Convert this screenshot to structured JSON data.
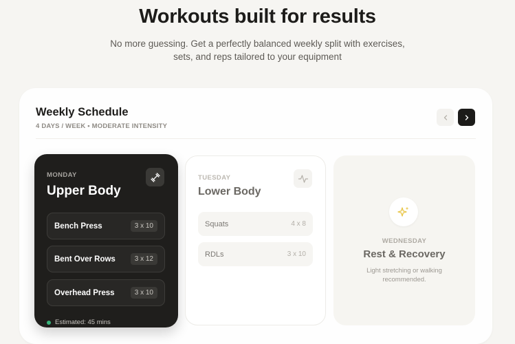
{
  "hero": {
    "title": "Workouts built for results",
    "subtitle_line1": "No more guessing. Get a perfectly balanced weekly split with exercises,",
    "subtitle_line2": "sets, and reps tailored to your equipment"
  },
  "schedule": {
    "title": "Weekly Schedule",
    "meta": "4 DAYS / WEEK • MODERATE INTENSITY",
    "prev_icon": "chevron-left-icon",
    "next_icon": "chevron-right-icon"
  },
  "monday": {
    "day": "MONDAY",
    "title": "Upper Body",
    "icon": "dumbbell-icon",
    "exercises": [
      {
        "name": "Bench Press",
        "sets": "3 x 10"
      },
      {
        "name": "Bent Over Rows",
        "sets": "3 x 12"
      },
      {
        "name": "Overhead Press",
        "sets": "3 x 10"
      }
    ],
    "estimated": "Estimated: 45 mins",
    "status_color": "#37b37a"
  },
  "tuesday": {
    "day": "TUESDAY",
    "title": "Lower Body",
    "icon": "activity-icon",
    "exercises": [
      {
        "name": "Squats",
        "sets": "4 x 8"
      },
      {
        "name": "RDLs",
        "sets": "3 x 10"
      }
    ]
  },
  "wednesday": {
    "day": "WEDNESDAY",
    "title": "Rest & Recovery",
    "icon": "sparkles-icon",
    "description_line1": "Light stretching or walking",
    "description_line2": "recommended.",
    "icon_color": "#e8c547"
  }
}
